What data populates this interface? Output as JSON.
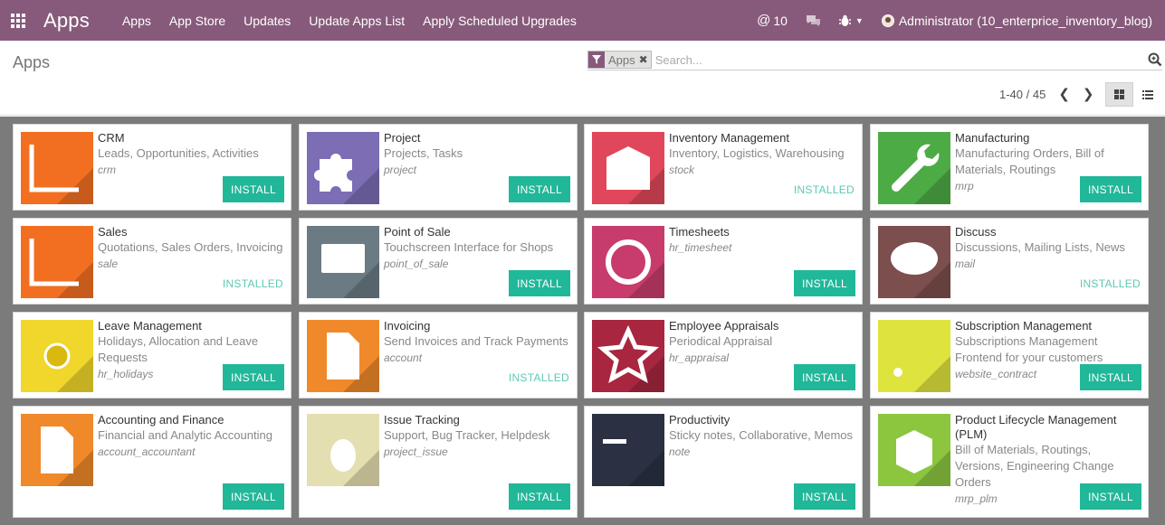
{
  "navbar": {
    "brand": "Apps",
    "menu": [
      "Apps",
      "App Store",
      "Updates",
      "Update Apps List",
      "Apply Scheduled Upgrades"
    ],
    "message_count": "10",
    "user": "Administrator (10_enterprice_inventory_blog)"
  },
  "control": {
    "title": "Apps",
    "facet": "Apps",
    "search_placeholder": "Search...",
    "pager": "1-40 / 45"
  },
  "install_label": "INSTALL",
  "installed_label": "INSTALLED",
  "apps": [
    {
      "name": "CRM",
      "summary": "Leads, Opportunities, Activities",
      "module": "crm",
      "installed": false,
      "color": "#f26f21",
      "icon": "chart-icon"
    },
    {
      "name": "Project",
      "summary": "Projects, Tasks",
      "module": "project",
      "installed": false,
      "color": "#7c6db5",
      "icon": "puzzle-icon"
    },
    {
      "name": "Inventory Management",
      "summary": "Inventory, Logistics, Warehousing",
      "module": "stock",
      "installed": true,
      "color": "#e0475a",
      "icon": "warehouse-icon"
    },
    {
      "name": "Manufacturing",
      "summary": "Manufacturing Orders, Bill of Materials, Routings",
      "module": "mrp",
      "installed": false,
      "color": "#4dab45",
      "icon": "wrench-icon"
    },
    {
      "name": "Sales",
      "summary": "Quotations, Sales Orders, Invoicing",
      "module": "sale",
      "installed": true,
      "color": "#f26f21",
      "icon": "chart-icon"
    },
    {
      "name": "Point of Sale",
      "summary": "Touchscreen Interface for Shops",
      "module": "point_of_sale",
      "installed": false,
      "color": "#6b7b84",
      "icon": "monitor-icon"
    },
    {
      "name": "Timesheets",
      "summary": "",
      "module": "hr_timesheet",
      "installed": false,
      "color": "#c73c6c",
      "icon": "clock-icon"
    },
    {
      "name": "Discuss",
      "summary": "Discussions, Mailing Lists, News",
      "module": "mail",
      "installed": true,
      "color": "#7d4e4e",
      "icon": "chat-bubble-icon"
    },
    {
      "name": "Leave Management",
      "summary": "Holidays, Allocation and Leave Requests",
      "module": "hr_holidays",
      "installed": false,
      "color": "#f1d62b",
      "icon": "sun-icon"
    },
    {
      "name": "Invoicing",
      "summary": "Send Invoices and Track Payments",
      "module": "account",
      "installed": true,
      "color": "#f0892a",
      "icon": "document-icon"
    },
    {
      "name": "Employee Appraisals",
      "summary": "Periodical Appraisal",
      "module": "hr_appraisal",
      "installed": false,
      "color": "#a8263f",
      "icon": "star-icon"
    },
    {
      "name": "Subscription Management",
      "summary": "Subscriptions Management Frontend for your customers",
      "module": "website_contract",
      "installed": false,
      "color": "#dfe33d",
      "icon": "rss-icon"
    },
    {
      "name": "Accounting and Finance",
      "summary": "Financial and Analytic Accounting",
      "module": "account_accountant",
      "installed": false,
      "color": "#f0892a",
      "icon": "document-icon"
    },
    {
      "name": "Issue Tracking",
      "summary": "Support, Bug Tracker, Helpdesk",
      "module": "project_issue",
      "installed": false,
      "color": "#e4dfb0",
      "icon": "bug-icon"
    },
    {
      "name": "Productivity",
      "summary": "Sticky notes, Collaborative, Memos",
      "module": "note",
      "installed": false,
      "color": "#2b3142",
      "icon": "notes-pen-icon"
    },
    {
      "name": "Product Lifecycle Management (PLM)",
      "summary": "Bill of Materials, Routings, Versions, Engineering Change Orders",
      "module": "mrp_plm",
      "installed": false,
      "color": "#8cc63f",
      "icon": "box-icon"
    }
  ]
}
